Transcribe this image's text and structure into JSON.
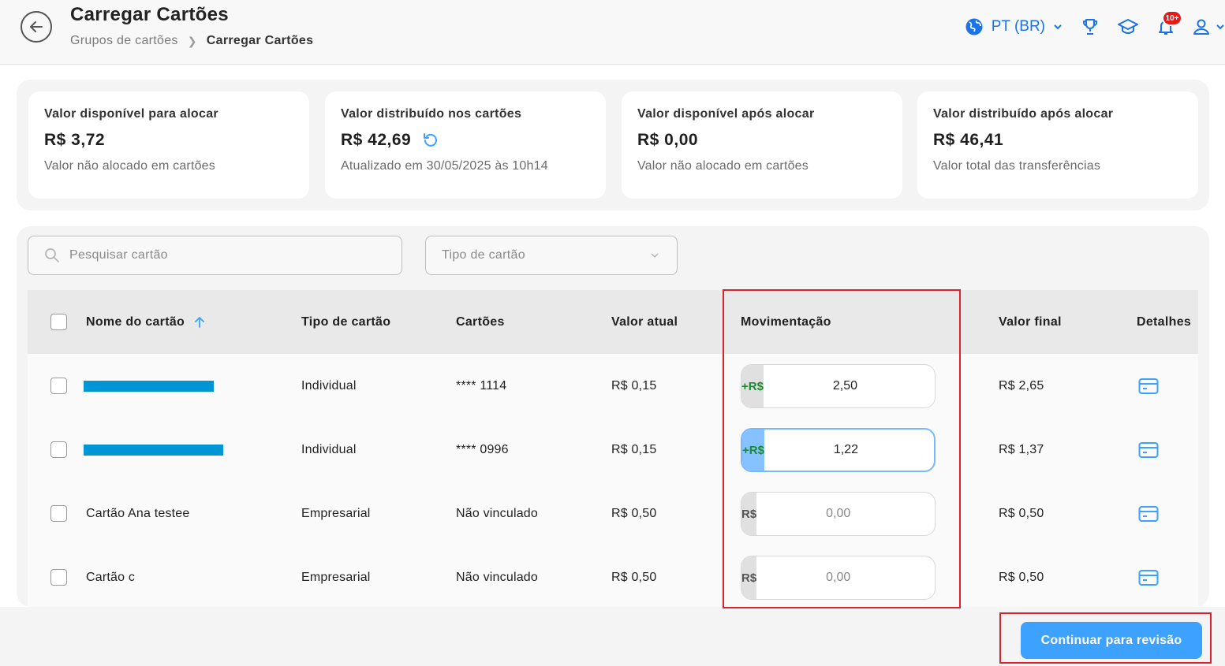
{
  "header": {
    "title": "Carregar Cartões",
    "breadcrumb": {
      "parent": "Grupos de cartões",
      "current": "Carregar Cartões"
    },
    "language": "PT (BR)",
    "notifications_badge": "10+"
  },
  "summary": [
    {
      "label": "Valor disponível para alocar",
      "value": "R$ 3,72",
      "sub": "Valor não alocado em cartões"
    },
    {
      "label": "Valor distribuído nos cartões",
      "value": "R$ 42,69",
      "sub": "Atualizado em 30/05/2025 às 10h14"
    },
    {
      "label": "Valor disponível após alocar",
      "value": "R$ 0,00",
      "sub": "Valor não alocado em cartões"
    },
    {
      "label": "Valor distribuído após alocar",
      "value": "R$ 46,41",
      "sub": "Valor total das transferências"
    }
  ],
  "filters": {
    "search_placeholder": "Pesquisar cartão",
    "type_placeholder": "Tipo de cartão"
  },
  "table": {
    "columns": {
      "name": "Nome do cartão",
      "type": "Tipo de cartão",
      "cards": "Cartões",
      "current": "Valor atual",
      "movement": "Movimentação",
      "final": "Valor final",
      "details": "Detalhes"
    },
    "rows": [
      {
        "name": "",
        "type": "Individual",
        "cards": "**** 1114",
        "current": "R$ 0,15",
        "prefix": "+R$",
        "movement": "2,50",
        "final": "R$ 2,65"
      },
      {
        "name": "",
        "type": "Individual",
        "cards": "**** 0996",
        "current": "R$ 0,15",
        "prefix": "+R$",
        "movement": "1,22",
        "final": "R$ 1,37"
      },
      {
        "name": "Cartão Ana testee",
        "type": "Empresarial",
        "cards": "Não vinculado",
        "current": "R$ 0,50",
        "prefix": "R$",
        "movement": "0,00",
        "final": "R$ 0,50"
      },
      {
        "name": "Cartão c",
        "type": "Empresarial",
        "cards": "Não vinculado",
        "current": "R$ 0,50",
        "prefix": "R$",
        "movement": "0,00",
        "final": "R$ 0,50"
      }
    ]
  },
  "actions": {
    "continue_label": "Continuar para revisão"
  },
  "colors": {
    "accent": "#3da1ff",
    "link": "#1a73e8",
    "positive": "#1c8a2e",
    "highlight": "#d9232e",
    "badge": "#e31b1b"
  },
  "icons": [
    "back-arrow-icon",
    "globe-icon",
    "chevron-down-icon",
    "trophy-icon",
    "graduation-cap-icon",
    "bell-icon",
    "user-icon",
    "search-icon",
    "sort-up-icon",
    "refresh-icon",
    "card-details-icon"
  ]
}
